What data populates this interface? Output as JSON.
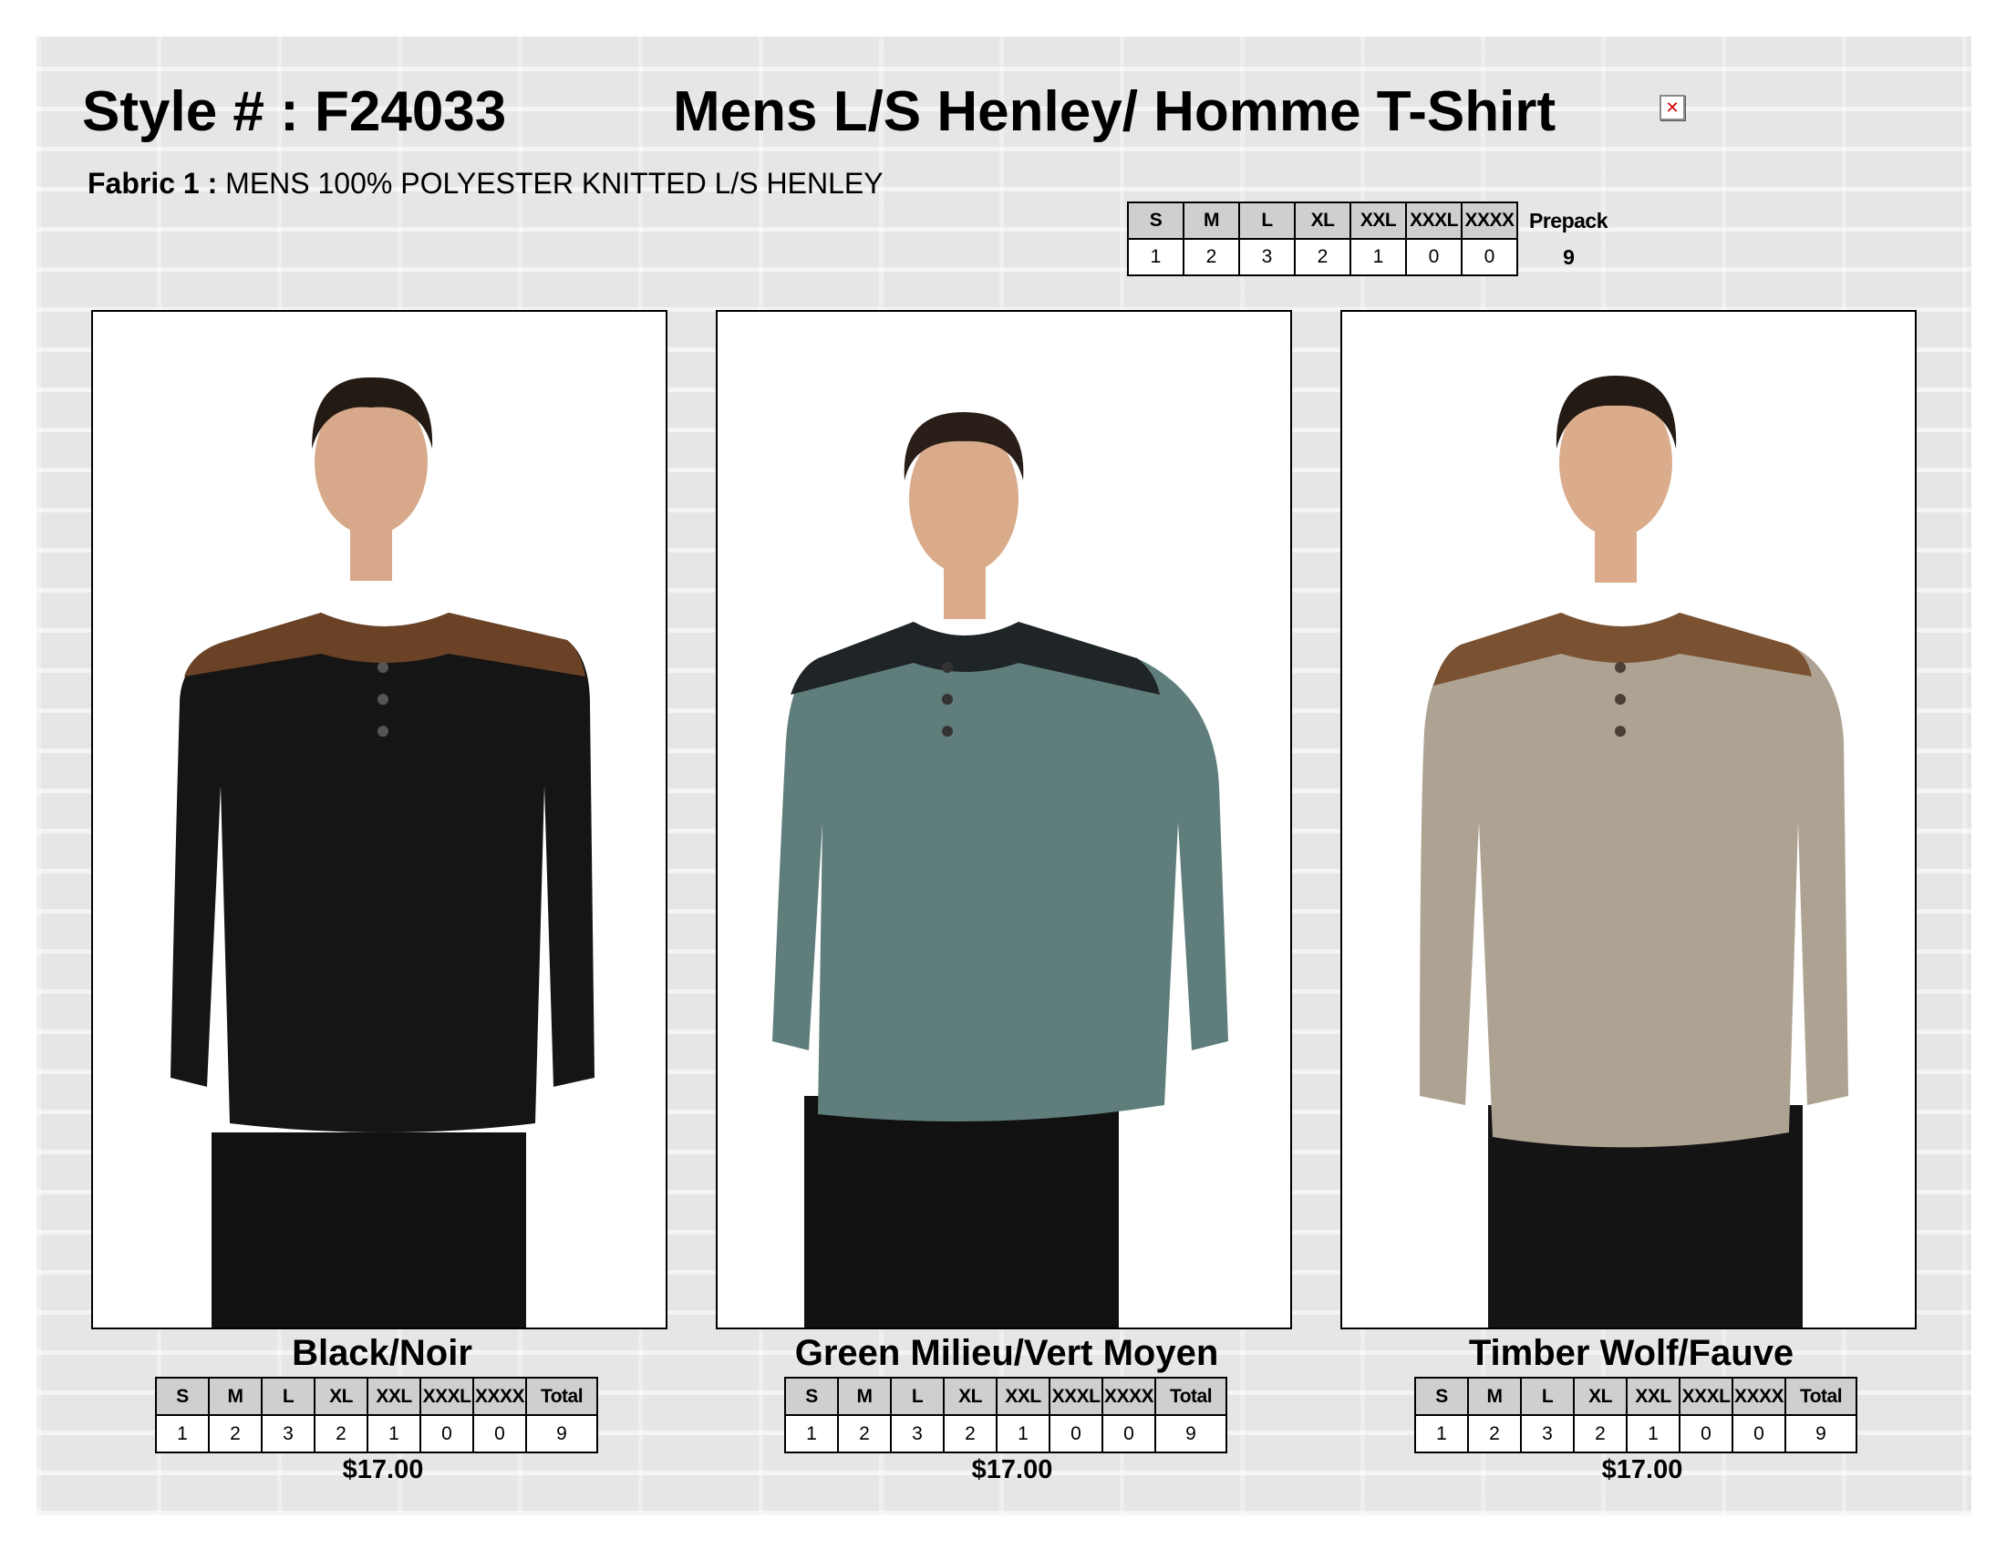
{
  "header": {
    "style_number": "Style # : F24033",
    "title": "Mens L/S Henley/ Homme T-Shirt",
    "fabric_label": "Fabric 1 :",
    "fabric_value": "MENS 100% POLYESTER KNITTED L/S HENLEY"
  },
  "prepack": {
    "sizes": [
      "S",
      "M",
      "L",
      "XL",
      "XXL",
      "XXXL",
      "XXXX"
    ],
    "quantities": [
      "1",
      "2",
      "3",
      "2",
      "1",
      "0",
      "0"
    ],
    "label": "Prepack",
    "total": "9"
  },
  "products": [
    {
      "color_name": "Black/Noir",
      "price": "$17.00",
      "sizes": [
        "S",
        "M",
        "L",
        "XL",
        "XXL",
        "XXXL",
        "XXXX"
      ],
      "total_label": "Total",
      "quantities": [
        "1",
        "2",
        "3",
        "2",
        "1",
        "0",
        "0"
      ],
      "total": "9",
      "shirt_color": "#151515",
      "yoke_color": "#6b4226"
    },
    {
      "color_name": "Green Milieu/Vert Moyen",
      "price": "$17.00",
      "sizes": [
        "S",
        "M",
        "L",
        "XL",
        "XXL",
        "XXXL",
        "XXXX"
      ],
      "total_label": "Total",
      "quantities": [
        "1",
        "2",
        "3",
        "2",
        "1",
        "0",
        "0"
      ],
      "total": "9",
      "shirt_color": "#5f7e7b",
      "yoke_color": "#1f2426"
    },
    {
      "color_name": "Timber Wolf/Fauve",
      "price": "$17.00",
      "sizes": [
        "S",
        "M",
        "L",
        "XL",
        "XXL",
        "XXXL",
        "XXXX"
      ],
      "total_label": "Total",
      "quantities": [
        "1",
        "2",
        "3",
        "2",
        "1",
        "0",
        "0"
      ],
      "total": "9",
      "shirt_color": "#aea392",
      "yoke_color": "#7a5232"
    }
  ]
}
